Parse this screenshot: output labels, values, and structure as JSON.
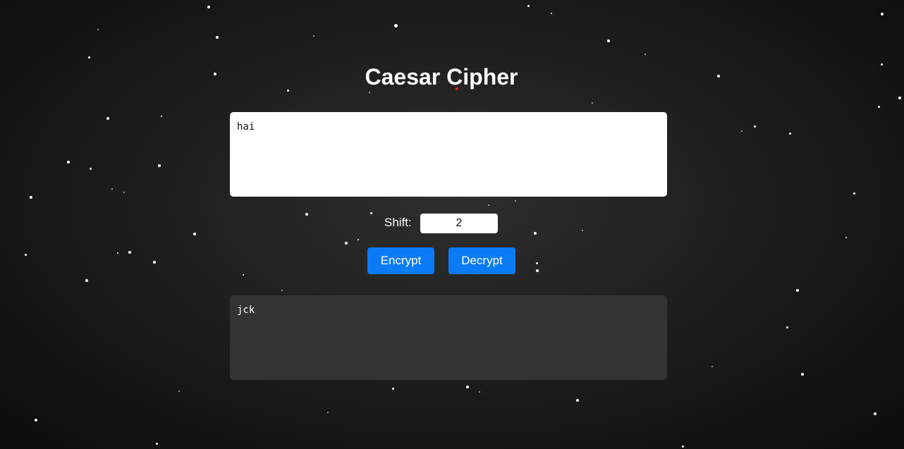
{
  "page": {
    "title": "Caesar Cipher"
  },
  "input": {
    "value": "hai"
  },
  "shift": {
    "label": "Shift:",
    "value": "2"
  },
  "buttons": {
    "encrypt_label": "Encrypt",
    "decrypt_label": "Decrypt"
  },
  "output": {
    "value": "jck"
  },
  "colors": {
    "button_background": "#0b7bf5",
    "page_background": "#222222",
    "output_background": "#333333",
    "star": "#ffffff"
  }
}
